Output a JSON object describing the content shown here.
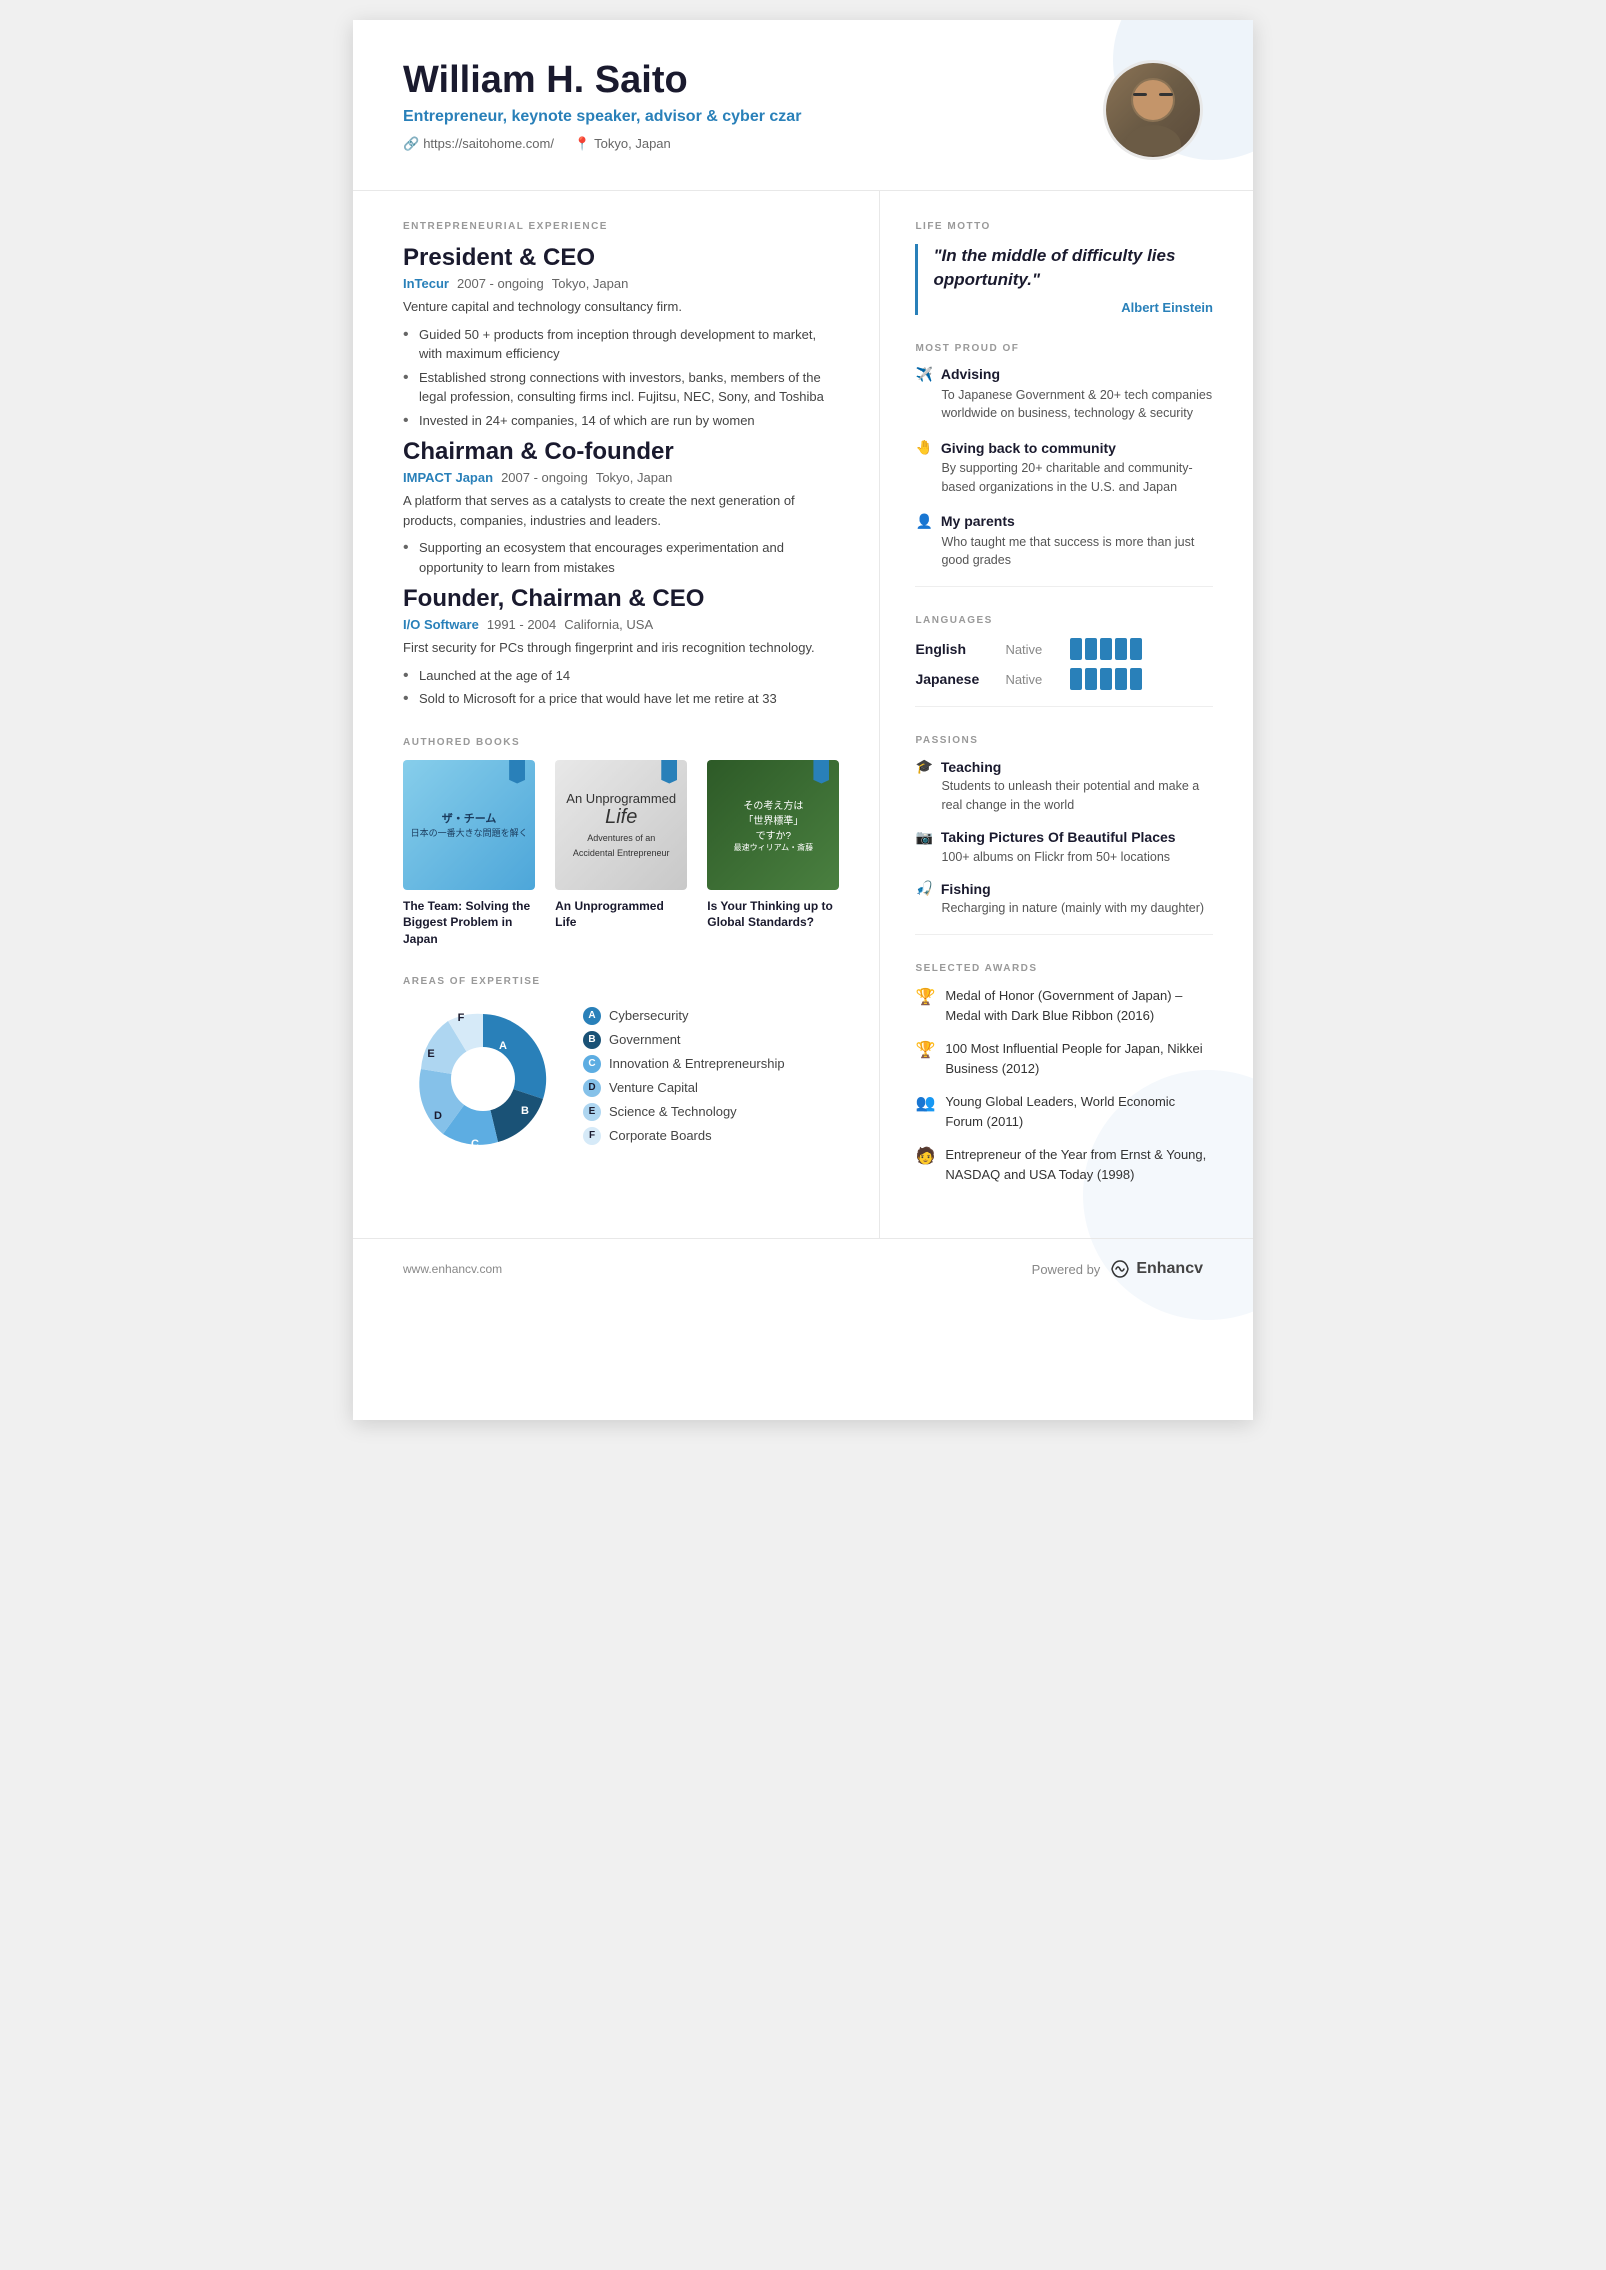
{
  "header": {
    "name": "William H. Saito",
    "title": "Entrepreneur, keynote speaker, advisor & cyber czar",
    "website": "https://saitohome.com/",
    "location": "Tokyo, Japan"
  },
  "sections": {
    "experience_label": "ENTREPRENEURIAL EXPERIENCE",
    "life_motto_label": "LIFE MOTTO",
    "most_proud_label": "MOST PROUD OF",
    "languages_label": "LANGUAGES",
    "passions_label": "PASSIONS",
    "awards_label": "SELECTED AWARDS",
    "books_label": "AUTHORED BOOKS",
    "expertise_label": "AREAS OF EXPERTISE"
  },
  "experience": [
    {
      "title": "President & CEO",
      "company": "InTecur",
      "period": "2007 - ongoing",
      "location": "Tokyo, Japan",
      "description": "Venture capital and technology consultancy firm.",
      "bullets": [
        "Guided 50 + products from inception through development to market, with maximum efficiency",
        "Established strong connections with investors, banks, members of the legal profession, consulting firms incl. Fujitsu, NEC, Sony, and Toshiba",
        "Invested in 24+ companies, 14 of which are run by women"
      ]
    },
    {
      "title": "Chairman & Co-founder",
      "company": "IMPACT Japan",
      "period": "2007 - ongoing",
      "location": "Tokyo, Japan",
      "description": "A platform that serves as a catalysts to create the next generation of products, companies, industries and leaders.",
      "bullets": [
        "Supporting an ecosystem that encourages experimentation and opportunity to learn from mistakes"
      ]
    },
    {
      "title": "Founder, Chairman & CEO",
      "company": "I/O Software",
      "period": "1991 - 2004",
      "location": "California, USA",
      "description": "First security for PCs through fingerprint and iris recognition technology.",
      "bullets": [
        "Launched at the age of 14",
        "Sold to Microsoft for a price that would have let me retire at 33"
      ]
    }
  ],
  "books": [
    {
      "title": "The Team: Solving the Biggest Problem in Japan",
      "cover_style": "1",
      "cover_text": "ザ・チーム"
    },
    {
      "title": "An Unprogrammed Life",
      "cover_style": "2",
      "cover_text": "An Unprogrammed Life"
    },
    {
      "title": "Is Your Thinking up to Global Standards?",
      "cover_style": "3",
      "cover_text": "世界標準ですか?"
    }
  ],
  "expertise": {
    "items": [
      {
        "letter": "A",
        "label": "Cybersecurity",
        "color": "#2980b9",
        "bg": "#2980b9"
      },
      {
        "letter": "B",
        "label": "Government",
        "color": "#1a5276",
        "bg": "#1a5276"
      },
      {
        "letter": "C",
        "label": "Innovation & Entrepreneurship",
        "color": "#5dade2",
        "bg": "#5dade2"
      },
      {
        "letter": "D",
        "label": "Venture Capital",
        "color": "#85c1e9",
        "bg": "#85c1e9"
      },
      {
        "letter": "E",
        "label": "Science & Technology",
        "color": "#aed6f1",
        "bg": "#aed6f1"
      },
      {
        "letter": "F",
        "label": "Corporate Boards",
        "color": "#d6eaf8",
        "bg": "#d6eaf8"
      }
    ]
  },
  "motto": {
    "text": "\"In the middle of difficulty lies opportunity.\"",
    "author": "Albert Einstein"
  },
  "proud": [
    {
      "icon": "✈",
      "title": "Advising",
      "desc": "To Japanese Government & 20+ tech companies worldwide on business, technology & security"
    },
    {
      "icon": "🤚",
      "title": "Giving back to community",
      "desc": "By supporting 20+ charitable and community-based organizations in the U.S. and Japan"
    },
    {
      "icon": "👨",
      "title": "My parents",
      "desc": "Who taught me that success is more than just good grades"
    }
  ],
  "languages": [
    {
      "name": "English",
      "level": "Native",
      "bars": 5
    },
    {
      "name": "Japanese",
      "level": "Native",
      "bars": 5
    }
  ],
  "passions": [
    {
      "icon": "🎓",
      "title": "Teaching",
      "desc": "Students to unleash their potential and make a real change in the world"
    },
    {
      "icon": "📷",
      "title": "Taking Pictures Of Beautiful Places",
      "desc": "100+ albums on Flickr from 50+ locations"
    },
    {
      "icon": "🎣",
      "title": "Fishing",
      "desc": "Recharging in nature (mainly with my daughter)"
    }
  ],
  "awards": [
    {
      "icon": "🏆",
      "text": "Medal of Honor (Government of Japan) – Medal with Dark Blue Ribbon (2016)"
    },
    {
      "icon": "🏆",
      "text": "100 Most Influential People for Japan, Nikkei Business (2012)"
    },
    {
      "icon": "👥",
      "text": "Young Global Leaders, World Economic Forum (2011)"
    },
    {
      "icon": "🧑",
      "text": "Entrepreneur of the Year from Ernst & Young, NASDAQ and USA Today (1998)"
    }
  ],
  "footer": {
    "url": "www.enhancv.com",
    "powered_by": "Powered by",
    "brand": "Enhancv"
  }
}
